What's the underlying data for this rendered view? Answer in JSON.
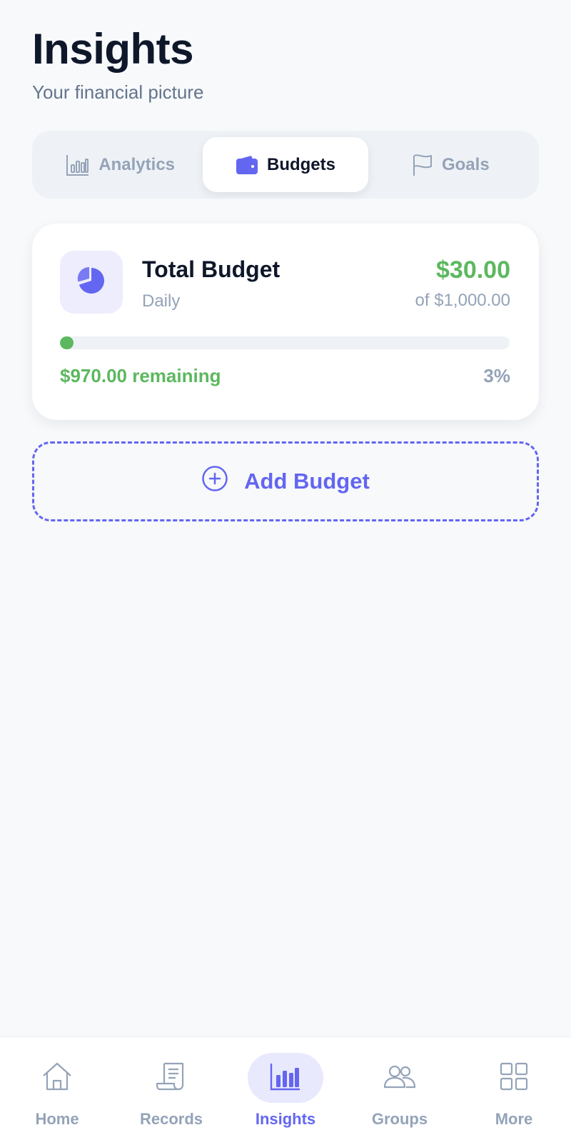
{
  "header": {
    "title": "Insights",
    "subtitle": "Your financial picture"
  },
  "tabs": [
    {
      "label": "Analytics",
      "icon": "bar-chart-icon",
      "active": false
    },
    {
      "label": "Budgets",
      "icon": "wallet-icon",
      "active": true
    },
    {
      "label": "Goals",
      "icon": "flag-icon",
      "active": false
    }
  ],
  "budget": {
    "icon": "pie-chart-icon",
    "name": "Total Budget",
    "period": "Daily",
    "spent": "$30.00",
    "limit": "of $1,000.00",
    "remaining": "$970.00 remaining",
    "percent_label": "3%",
    "progress_fraction": 0.03
  },
  "add_budget": {
    "label": "Add Budget",
    "icon": "plus-circle-icon"
  },
  "nav": [
    {
      "label": "Home",
      "icon": "home-icon",
      "active": false
    },
    {
      "label": "Records",
      "icon": "receipt-icon",
      "active": false
    },
    {
      "label": "Insights",
      "icon": "bar-chart-icon",
      "active": true
    },
    {
      "label": "Groups",
      "icon": "users-icon",
      "active": false
    },
    {
      "label": "More",
      "icon": "grid-icon",
      "active": false
    }
  ],
  "colors": {
    "accent": "#6366f1",
    "success": "#5cb85f",
    "muted": "#94a3b8",
    "background": "#f7f9fb"
  }
}
